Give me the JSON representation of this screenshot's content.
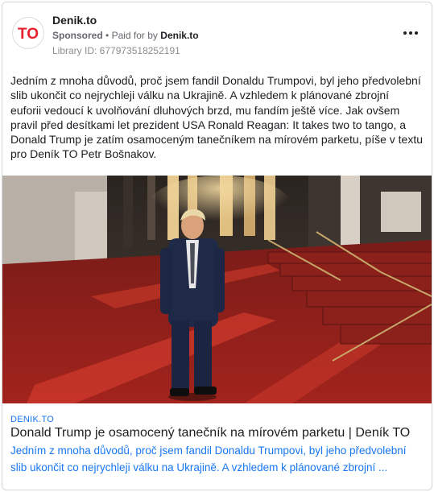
{
  "ad": {
    "page_name": "Denik.to",
    "sponsored_label": "Sponsored",
    "separator": "•",
    "paid_for_prefix": "Paid for by",
    "paid_for_by": "Denik.to",
    "library_id": "Library ID: 677973518252191",
    "more_icon": "three-dots-icon",
    "avatar_text": "TO",
    "brand_color": "#e5212e"
  },
  "body": {
    "text": "Jedním z mnoha důvodů, proč jsem fandil Donaldu Trumpovi, byl jeho předvolební slib ukončit co nejrychleji válku na Ukrajině. A vzhledem k plánované zbrojní euforii vedoucí k uvolňování dluhových brzd, mu fandím ještě více. Jak ovšem pravil před desítkami let prezident USA Ronald Reagan: It takes two to tango, a Donald Trump je zatím osamoceným tanečníkem na mírovém parketu, píše v textu pro Deník TO Petr Bošnakov."
  },
  "link": {
    "domain": "DENIK.TO",
    "title": "Donald Trump je osamocený tanečník na mírovém parketu | Deník TO",
    "description": "Jedním z mnoha důvodů, proč jsem fandil Donaldu Trumpovi, byl jeho předvolební slib ukončit co nejrychleji válku na Ukrajině. A vzhledem k plánované zbrojní ...",
    "link_color": "#1877f2"
  }
}
